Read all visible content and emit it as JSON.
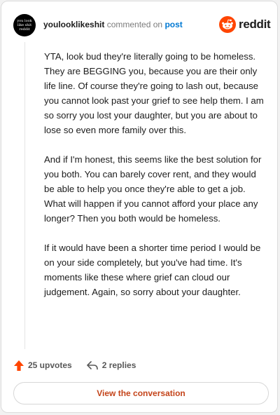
{
  "header": {
    "username": "youlooklikeshit",
    "commented_text": "commented on",
    "post_link": "post",
    "logo_text": "reddit",
    "avatar_text": [
      "you look",
      "like shit",
      "reddit"
    ]
  },
  "comment": {
    "paragraphs": [
      "YTA, look bud they're literally going to be homeless. They are BEGGING you, because you are their only life line. Of course they're going to lash out, because you cannot look past your grief to see help them. I am so sorry you lost your daughter, but you are about to lose so even more family over this.",
      "And if I'm honest, this seems like the best solution for you both. You can barely cover rent, and they would be able to help you once they're able to get a job. What will happen if you cannot afford your place any longer? Then you both would be homeless.",
      "If it would have been a shorter time period I would be on your side completely, but you've had time. It's moments like these where grief can cloud our judgement. Again, so sorry about your daughter."
    ]
  },
  "actions": {
    "upvotes_label": "25 upvotes",
    "replies_label": "2 replies"
  },
  "footer": {
    "view_label": "View the conversation"
  },
  "colors": {
    "reddit_orange": "#ff4500",
    "link_blue": "#0079d3",
    "view_text": "#c4441a"
  },
  "icons": [
    "avatar",
    "reddit-logo-icon",
    "upvote-arrow-icon",
    "reply-icon"
  ]
}
